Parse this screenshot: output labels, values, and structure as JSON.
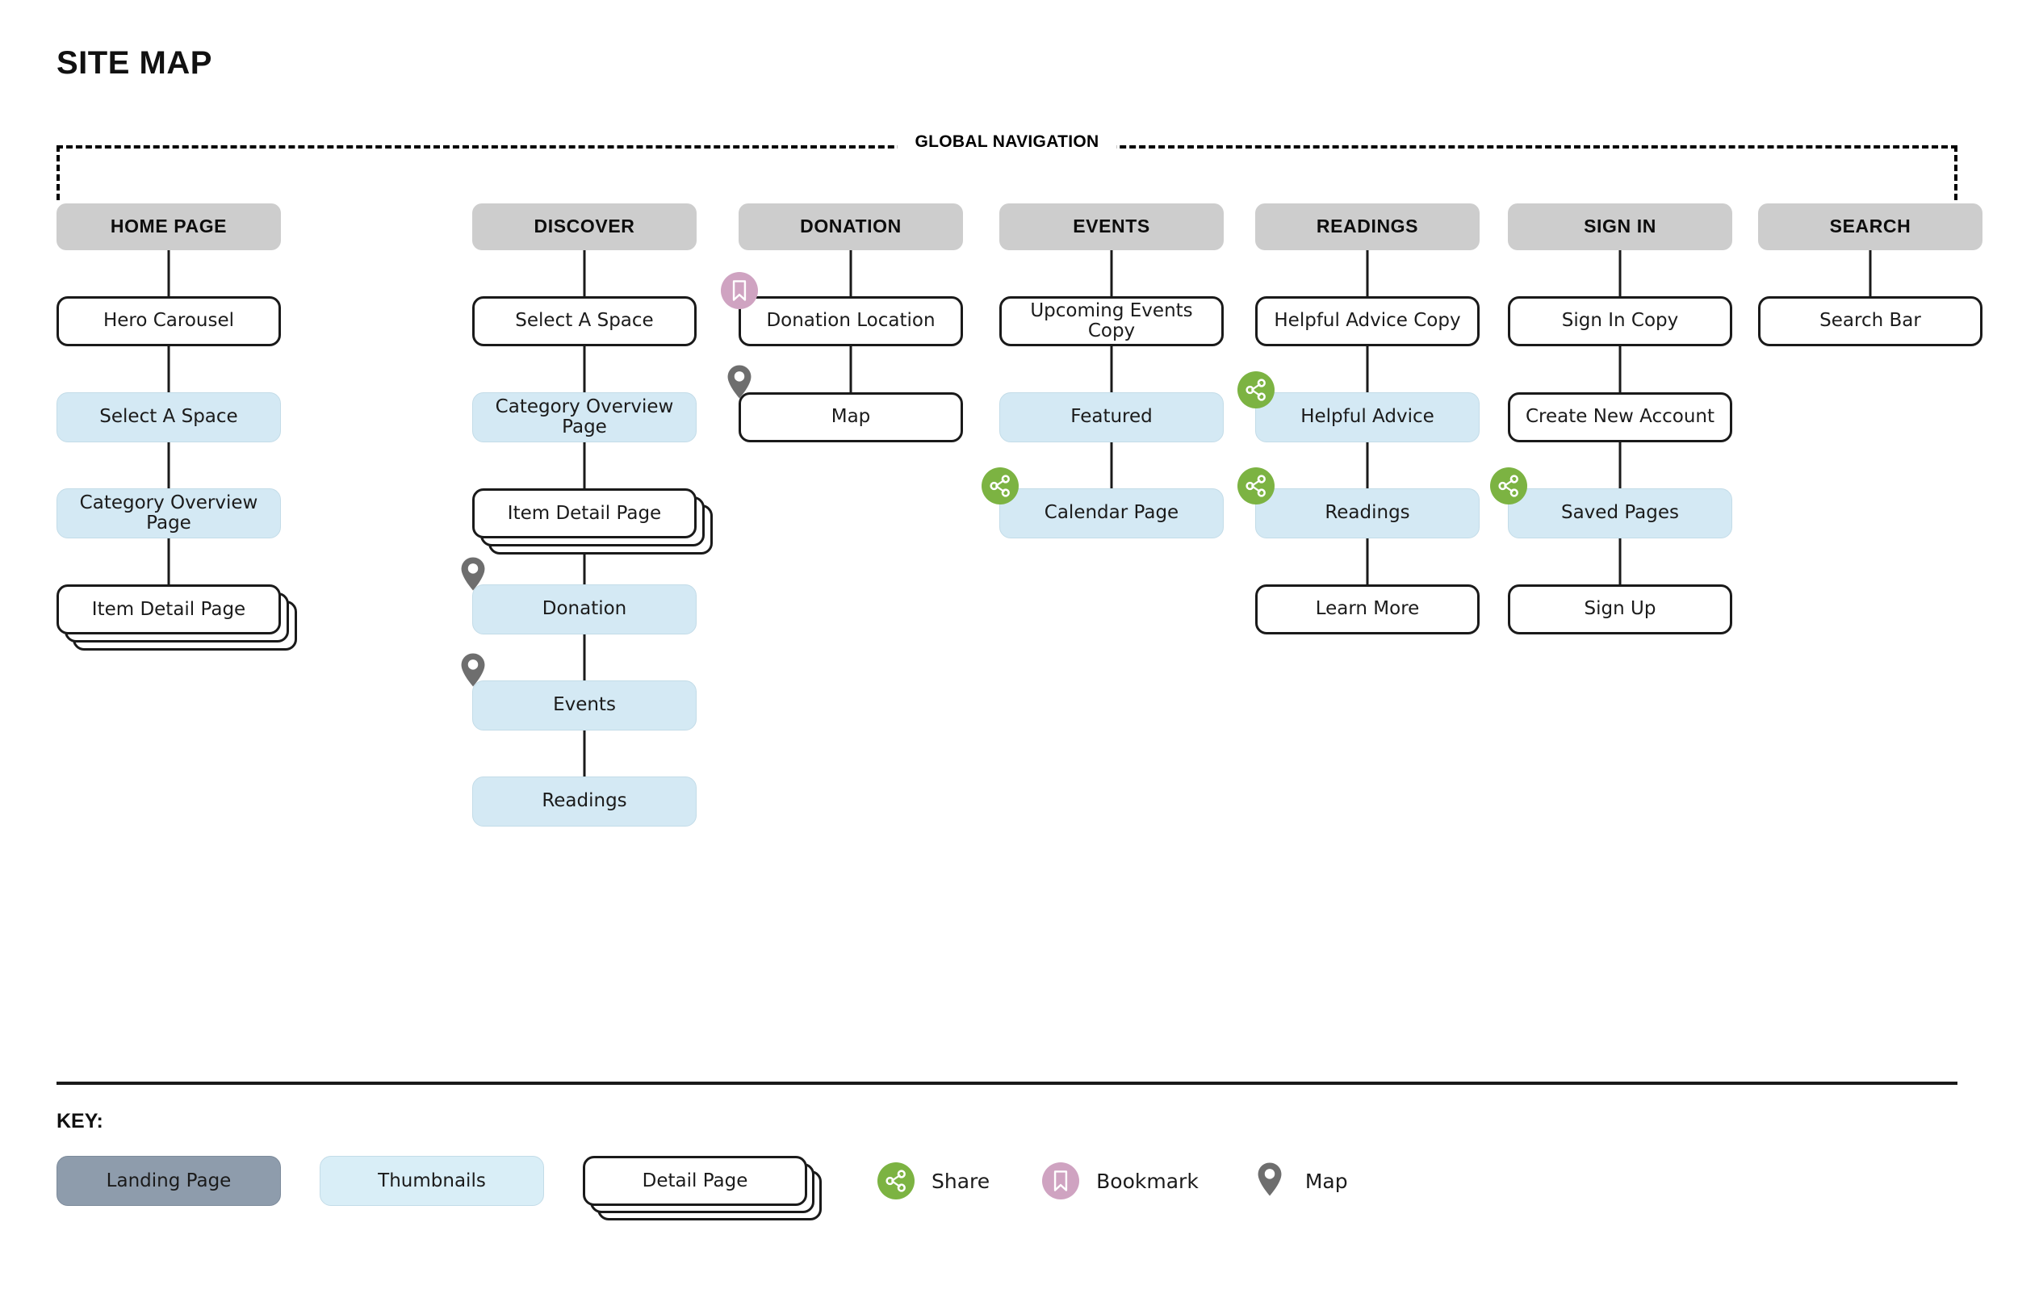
{
  "title": "SITE MAP",
  "global_nav": {
    "label": "GLOBAL NAVIGATION"
  },
  "colors": {
    "landing_header": "#cdcdcd",
    "landing_key": "#8e9cac",
    "thumbnail": "#d4e9f4",
    "share_green": "#7cb342",
    "bookmark_pink": "#cfa3c1",
    "map_gray": "#6e6e6e",
    "stroke": "#1a1a1a"
  },
  "columns": [
    {
      "id": "home-page",
      "header": "HOME PAGE",
      "nodes": [
        {
          "label": "Hero Carousel",
          "type": "page",
          "badge": null
        },
        {
          "label": "Select A Space",
          "type": "thumb",
          "badge": null
        },
        {
          "label": "Category Overview Page",
          "type": "thumb",
          "badge": null
        },
        {
          "label": "Item Detail Page",
          "type": "stack",
          "badge": null
        }
      ]
    },
    {
      "id": "discover",
      "header": "DISCOVER",
      "nodes": [
        {
          "label": "Select A Space",
          "type": "page",
          "badge": null
        },
        {
          "label": "Category Overview Page",
          "type": "thumb",
          "badge": null
        },
        {
          "label": "Item Detail Page",
          "type": "stack",
          "badge": null
        },
        {
          "label": "Donation",
          "type": "thumb",
          "badge": "map"
        },
        {
          "label": "Events",
          "type": "thumb",
          "badge": "map"
        },
        {
          "label": "Readings",
          "type": "thumb",
          "badge": null
        }
      ]
    },
    {
      "id": "donation",
      "header": "DONATION",
      "nodes": [
        {
          "label": "Donation Location",
          "type": "page",
          "badge": "bookmark"
        },
        {
          "label": "Map",
          "type": "page",
          "badge": "map"
        }
      ]
    },
    {
      "id": "events",
      "header": "EVENTS",
      "nodes": [
        {
          "label": "Upcoming Events Copy",
          "type": "page",
          "badge": null
        },
        {
          "label": "Featured",
          "type": "thumb",
          "badge": null
        },
        {
          "label": "Calendar Page",
          "type": "thumb",
          "badge": "share"
        }
      ]
    },
    {
      "id": "readings",
      "header": "READINGS",
      "nodes": [
        {
          "label": "Helpful Advice Copy",
          "type": "page",
          "badge": null
        },
        {
          "label": "Helpful Advice",
          "type": "thumb",
          "badge": "share"
        },
        {
          "label": "Readings",
          "type": "thumb",
          "badge": "share"
        },
        {
          "label": "Learn More",
          "type": "page",
          "badge": null
        }
      ]
    },
    {
      "id": "sign-in",
      "header": "SIGN IN",
      "nodes": [
        {
          "label": "Sign In Copy",
          "type": "page",
          "badge": null
        },
        {
          "label": "Create New Account",
          "type": "page",
          "badge": null
        },
        {
          "label": "Saved Pages",
          "type": "thumb",
          "badge": "share"
        },
        {
          "label": "Sign Up",
          "type": "page",
          "badge": null
        }
      ]
    },
    {
      "id": "search",
      "header": "SEARCH",
      "nodes": [
        {
          "label": "Search Bar",
          "type": "page",
          "badge": null
        }
      ]
    }
  ],
  "key": {
    "title": "KEY:",
    "swatches": [
      {
        "id": "landing-page",
        "label": "Landing Page",
        "style": "landing"
      },
      {
        "id": "thumbnails",
        "label": "Thumbnails",
        "style": "thumb"
      },
      {
        "id": "detail-page",
        "label": "Detail Page",
        "style": "stack"
      }
    ],
    "icons": [
      {
        "id": "share",
        "label": "Share"
      },
      {
        "id": "bookmark",
        "label": "Bookmark"
      },
      {
        "id": "map",
        "label": "Map"
      }
    ]
  }
}
